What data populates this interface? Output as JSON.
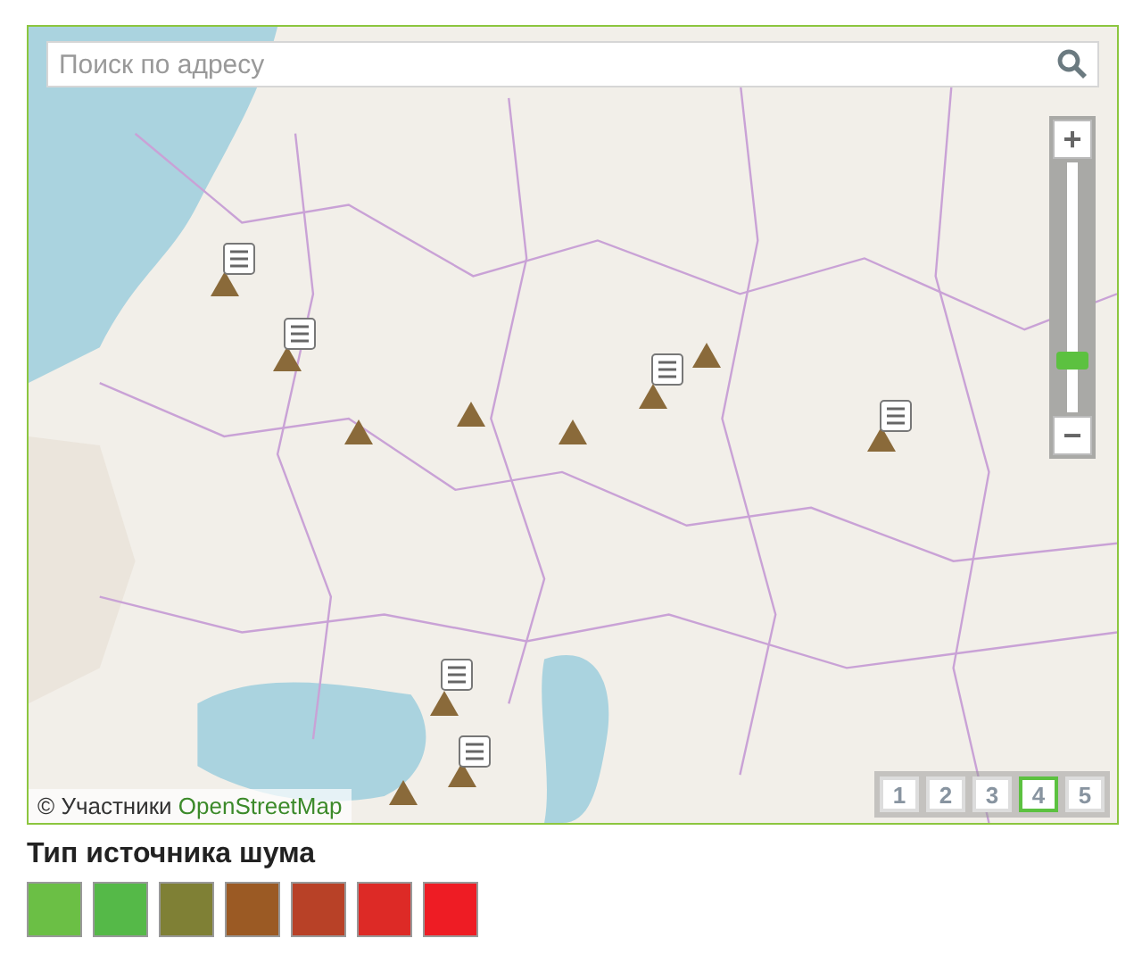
{
  "search": {
    "placeholder": "Поиск по адресу"
  },
  "zoom": {
    "plus": "+",
    "minus": "−",
    "level": 0.17
  },
  "attribution": {
    "prefix": "© Участники",
    "link": "OpenStreetMap"
  },
  "pages": [
    {
      "label": "1",
      "selected": false
    },
    {
      "label": "2",
      "selected": false
    },
    {
      "label": "3",
      "selected": false
    },
    {
      "label": "4",
      "selected": true
    },
    {
      "label": "5",
      "selected": false
    }
  ],
  "legend": {
    "title": "Тип источника шума",
    "items": [
      {
        "color": "#6bbf45"
      },
      {
        "color": "#55b948"
      },
      {
        "color": "#7f8035"
      },
      {
        "color": "#9b5a24"
      },
      {
        "color": "#b84127"
      },
      {
        "color": "#dd2a26"
      },
      {
        "color": "#ee1c24"
      }
    ]
  }
}
